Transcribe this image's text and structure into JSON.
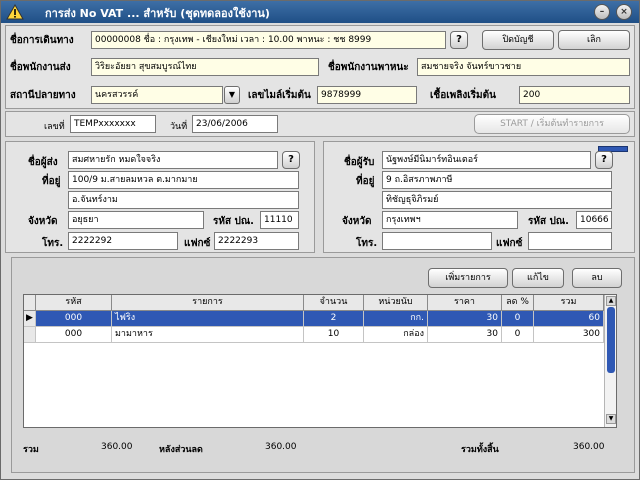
{
  "window": {
    "title": "การส่ง No VAT ... สำหรับ  (ชุดทดลองใช้งาน)"
  },
  "header": {
    "account_label": "ชื่อการเดินทาง",
    "account_value": "00000008 ชื่อ : กรุงเทพ - เชียงใหม่  เวลา : 10.00  พาหนะ : ชช 8999",
    "close_account_label": "ปิดบัญชี",
    "cancel_label": "เลิก",
    "sender_staff_label": "ชื่อพนักงานส่ง",
    "sender_staff_value": "วิริยะอัยยา  สุขสมบูรณ์ไทย",
    "vehicle_staff_label": "ชื่อพนักงานพาหนะ",
    "vehicle_staff_value": "สมชายจริง จันทร์ขาวชาย",
    "destination_label": "สถานีปลายทาง",
    "destination_value": "นครสวรรค์",
    "start_mile_label": "เลขไมล์เริ่มต้น",
    "start_mile_value": "9878999",
    "start_fuel_label": "เชื้อเพลิงเริ่มต้น",
    "start_fuel_value": "200"
  },
  "doc": {
    "number_label": "เลขที่",
    "number_value": "TEMPxxxxxxx",
    "date_label": "วันที่",
    "date_value": "23/06/2006",
    "start_button": "START / เริ่มต้นทำรายการ"
  },
  "sender": {
    "name_label": "ชื่อผู้ส่ง",
    "name_value": "สมศหายรัก หมดใจจริง",
    "address_label": "ที่อยู่",
    "address_line1": "100/9 ม.สายลมหวล ต.มากมาย",
    "address_line2": "อ.จันทร์งาม",
    "province_label": "จังหวัด",
    "province_value": "อยุธยา",
    "postcode_label": "รหัส ปณ.",
    "postcode_value": "11110",
    "phone_label": "โทร.",
    "phone_value": "2222292",
    "fax_label": "แฟกซ์",
    "fax_value": "2222293"
  },
  "receiver": {
    "name_label": "ชื่อผู้รับ",
    "name_value": "นัฐพงษ์มีนิมาร์ทอินเตอร์",
    "address_label": "ที่อยู่",
    "address_line1": "9 ถ.อิสรภาพภาษี",
    "address_line2": "ทิชัญธุจิภิรมย์",
    "province_label": "จังหวัด",
    "province_value": "กรุงเทพฯ",
    "postcode_label": "รหัส ปณ.",
    "postcode_value": "10666",
    "phone_label": "โทร.",
    "phone_value": "",
    "fax_label": "แฟกซ์",
    "fax_value": ""
  },
  "items": {
    "add_button": "เพิ่มรายการ",
    "edit_button": "แก้ไข",
    "delete_button": "ลบ",
    "columns": [
      "รหัส",
      "รายการ",
      "จำนวน",
      "หน่วยนับ",
      "ราคา",
      "ลด %",
      "รวม"
    ],
    "rows": [
      [
        "000",
        "ไฟริง",
        "2",
        "กก.",
        "30",
        "0",
        "60"
      ],
      [
        "000",
        "มามาหาร",
        "10",
        "กล่อง",
        "30",
        "0",
        "300"
      ]
    ]
  },
  "totals": {
    "total_label": "รวม",
    "total_value": "360.00",
    "after_discount_label": "หลังส่วนลด",
    "after_discount_value": "360.00",
    "grand_total_label": "รวมทั้งสิ้น",
    "grand_total_value": "360.00"
  }
}
